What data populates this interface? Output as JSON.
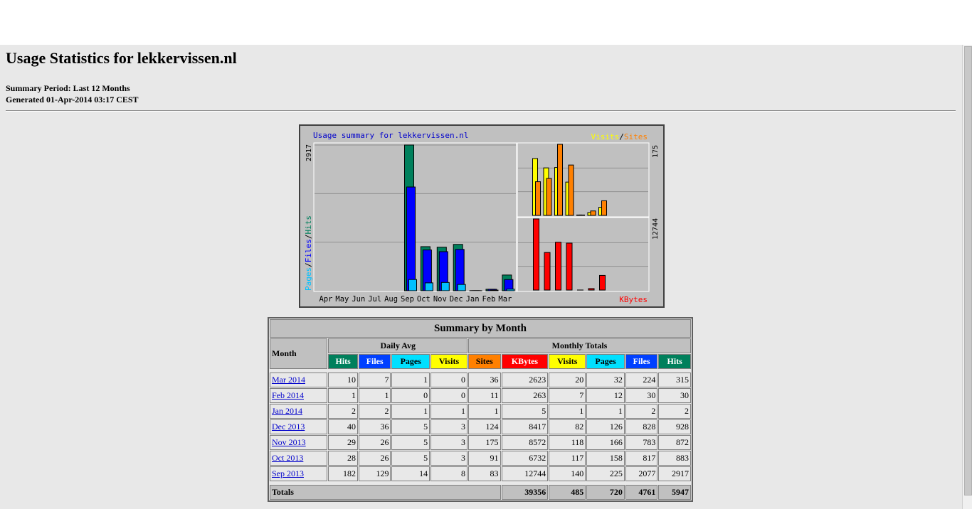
{
  "page": {
    "title": "Usage Statistics for lekkervissen.nl",
    "summary_period": "Summary Period: Last 12 Months",
    "generated": "Generated 01-Apr-2014 03:17 CEST"
  },
  "graph": {
    "title": "Usage summary for lekkervissen.nl",
    "left_max_label": "2917",
    "right_top_max_label": "175",
    "right_bottom_max_label": "12744",
    "legend_pages": "Pages",
    "legend_files": "Files",
    "legend_hits": "Hits",
    "legend_visits": "Visits",
    "legend_sites": "Sites",
    "legend_kbytes": "KBytes",
    "slash": "/",
    "colors": {
      "hits": "#00805c",
      "files": "#0000ff",
      "pages": "#00c0ff",
      "visits": "#ffff00",
      "sites": "#ff8000",
      "kbytes": "#ff0000"
    }
  },
  "chart_data": {
    "type": "bar",
    "categories": [
      "Apr",
      "May",
      "Jun",
      "Jul",
      "Aug",
      "Sep",
      "Oct",
      "Nov",
      "Dec",
      "Jan",
      "Feb",
      "Mar"
    ],
    "series": [
      {
        "name": "Hits",
        "values": [
          0,
          0,
          0,
          0,
          0,
          2917,
          883,
          872,
          928,
          2,
          30,
          315
        ]
      },
      {
        "name": "Files",
        "values": [
          0,
          0,
          0,
          0,
          0,
          2077,
          817,
          783,
          828,
          2,
          30,
          224
        ]
      },
      {
        "name": "Pages",
        "values": [
          0,
          0,
          0,
          0,
          0,
          225,
          158,
          166,
          126,
          1,
          12,
          32
        ]
      },
      {
        "name": "Visits",
        "values": [
          0,
          0,
          0,
          0,
          0,
          140,
          117,
          118,
          82,
          1,
          7,
          20
        ]
      },
      {
        "name": "Sites",
        "values": [
          0,
          0,
          0,
          0,
          0,
          83,
          91,
          175,
          124,
          1,
          11,
          36
        ]
      },
      {
        "name": "KBytes",
        "values": [
          0,
          0,
          0,
          0,
          0,
          12744,
          6732,
          8572,
          8417,
          5,
          263,
          2623
        ]
      }
    ],
    "title": "Usage summary for lekkervissen.nl",
    "ylim_hits": [
      0,
      2917
    ],
    "ylim_sites": [
      0,
      175
    ],
    "ylim_kbytes": [
      0,
      12744
    ],
    "grid": true
  },
  "table": {
    "title": "Summary by Month",
    "month_header": "Month",
    "daily_avg_header": "Daily Avg",
    "monthly_totals_header": "Monthly Totals",
    "col_hits": "Hits",
    "col_files": "Files",
    "col_pages": "Pages",
    "col_visits": "Visits",
    "col_sites": "Sites",
    "col_kbytes": "KBytes",
    "rows": [
      {
        "month": "Mar 2014",
        "d_hits": "10",
        "d_files": "7",
        "d_pages": "1",
        "d_visits": "0",
        "sites": "36",
        "kbytes": "2623",
        "visits": "20",
        "pages": "32",
        "files": "224",
        "hits": "315"
      },
      {
        "month": "Feb 2014",
        "d_hits": "1",
        "d_files": "1",
        "d_pages": "0",
        "d_visits": "0",
        "sites": "11",
        "kbytes": "263",
        "visits": "7",
        "pages": "12",
        "files": "30",
        "hits": "30"
      },
      {
        "month": "Jan 2014",
        "d_hits": "2",
        "d_files": "2",
        "d_pages": "1",
        "d_visits": "1",
        "sites": "1",
        "kbytes": "5",
        "visits": "1",
        "pages": "1",
        "files": "2",
        "hits": "2"
      },
      {
        "month": "Dec 2013",
        "d_hits": "40",
        "d_files": "36",
        "d_pages": "5",
        "d_visits": "3",
        "sites": "124",
        "kbytes": "8417",
        "visits": "82",
        "pages": "126",
        "files": "828",
        "hits": "928"
      },
      {
        "month": "Nov 2013",
        "d_hits": "29",
        "d_files": "26",
        "d_pages": "5",
        "d_visits": "3",
        "sites": "175",
        "kbytes": "8572",
        "visits": "118",
        "pages": "166",
        "files": "783",
        "hits": "872"
      },
      {
        "month": "Oct 2013",
        "d_hits": "28",
        "d_files": "26",
        "d_pages": "5",
        "d_visits": "3",
        "sites": "91",
        "kbytes": "6732",
        "visits": "117",
        "pages": "158",
        "files": "817",
        "hits": "883"
      },
      {
        "month": "Sep 2013",
        "d_hits": "182",
        "d_files": "129",
        "d_pages": "14",
        "d_visits": "8",
        "sites": "83",
        "kbytes": "12744",
        "visits": "140",
        "pages": "225",
        "files": "2077",
        "hits": "2917"
      }
    ],
    "totals": {
      "label": "Totals",
      "kbytes": "39356",
      "visits": "485",
      "pages": "720",
      "files": "4761",
      "hits": "5947"
    }
  }
}
